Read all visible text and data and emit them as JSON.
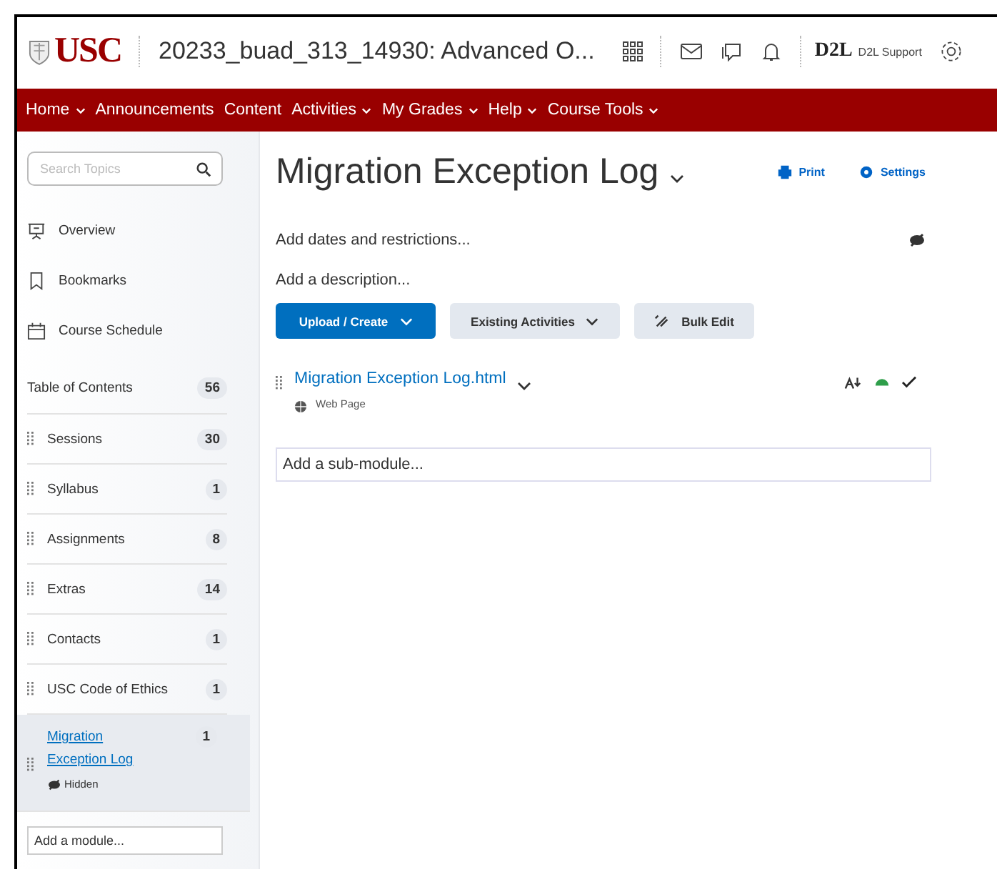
{
  "header": {
    "logo": "USC",
    "course": "20233_buad_313_14930: Advanced O...",
    "brand": "D2L",
    "brand_caption": "D2L Support"
  },
  "nav": [
    {
      "label": "Home",
      "menu": true
    },
    {
      "label": "Announcements",
      "menu": false
    },
    {
      "label": "Content",
      "menu": false
    },
    {
      "label": "Activities",
      "menu": true
    },
    {
      "label": "My Grades",
      "menu": true
    },
    {
      "label": "Help",
      "menu": true
    },
    {
      "label": "Course Tools",
      "menu": true
    }
  ],
  "sidebar": {
    "search": {
      "placeholder": "Search Topics"
    },
    "links": [
      {
        "kind": "overview",
        "label": "Overview"
      },
      {
        "kind": "bookmark",
        "label": "Bookmarks"
      },
      {
        "kind": "calendar",
        "label": "Course Schedule"
      }
    ],
    "toc": {
      "label": "Table of Contents",
      "count": "56"
    },
    "modules": [
      {
        "title": "Sessions",
        "count": "30",
        "selected": false
      },
      {
        "title": "Syllabus",
        "count": "1",
        "selected": false
      },
      {
        "title": "Assignments",
        "count": "8",
        "selected": false
      },
      {
        "title": "Extras",
        "count": "14",
        "selected": false
      },
      {
        "title": "Contacts",
        "count": "1",
        "selected": false
      },
      {
        "title": "USC Code of Ethics",
        "count": "1",
        "selected": false
      },
      {
        "title": "Migration Exception Log",
        "count": "1",
        "selected": true,
        "status": "Hidden"
      }
    ],
    "add_module": {
      "placeholder": "Add a module..."
    }
  },
  "main": {
    "title": "Migration Exception Log",
    "actions": [
      "Print",
      "Settings"
    ],
    "dates_link": "Add dates and restrictions...",
    "description_link": "Add a description...",
    "buttons": [
      {
        "kind": "primary",
        "label": "Upload / Create"
      },
      {
        "kind": "menu",
        "label": "Existing Activities"
      },
      {
        "kind": "bulk",
        "label": "Bulk Edit"
      }
    ],
    "topics": [
      {
        "title": "Migration Exception Log.html",
        "type": "Web Page",
        "completed": true
      }
    ],
    "add_submodule": {
      "placeholder": "Add a sub-module..."
    }
  }
}
